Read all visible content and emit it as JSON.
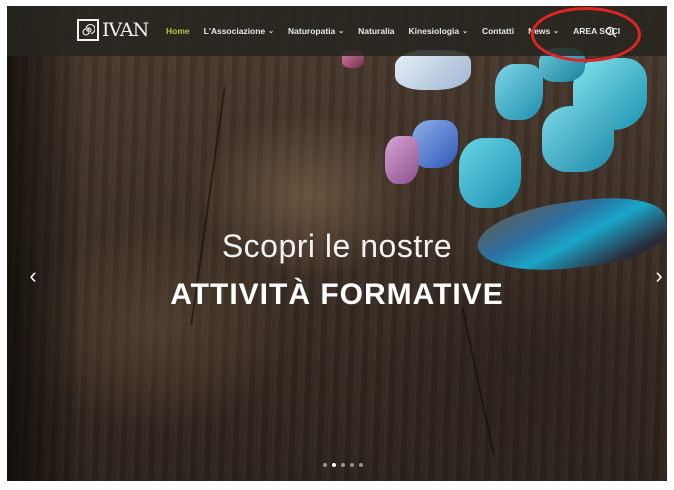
{
  "logo": {
    "text": "IVAN",
    "icon": "spiral-logo-icon"
  },
  "nav": {
    "items": [
      {
        "label": "Home",
        "active": true,
        "dropdown": false
      },
      {
        "label": "L'Associazione",
        "active": false,
        "dropdown": true
      },
      {
        "label": "Naturopatia",
        "active": false,
        "dropdown": true
      },
      {
        "label": "Naturalia",
        "active": false,
        "dropdown": false
      },
      {
        "label": "Kinesiologia",
        "active": false,
        "dropdown": true
      },
      {
        "label": "Contatti",
        "active": false,
        "dropdown": false
      },
      {
        "label": "News",
        "active": false,
        "dropdown": true
      },
      {
        "label": "AREA SOCI",
        "active": false,
        "dropdown": false
      }
    ],
    "search_icon": "search-icon",
    "active_color": "#b7c742"
  },
  "hero": {
    "line1": "Scopri le nostre",
    "line2": "ATTIVITÀ FORMATIVE",
    "prev_icon": "chevron-left-icon",
    "next_icon": "chevron-right-icon",
    "prev_glyph": "‹",
    "next_glyph": "›"
  },
  "slider": {
    "slide_count": 5,
    "active_slide": 2
  },
  "annotation": {
    "highlight_color": "#e02424",
    "target": "AREA SOCI"
  }
}
